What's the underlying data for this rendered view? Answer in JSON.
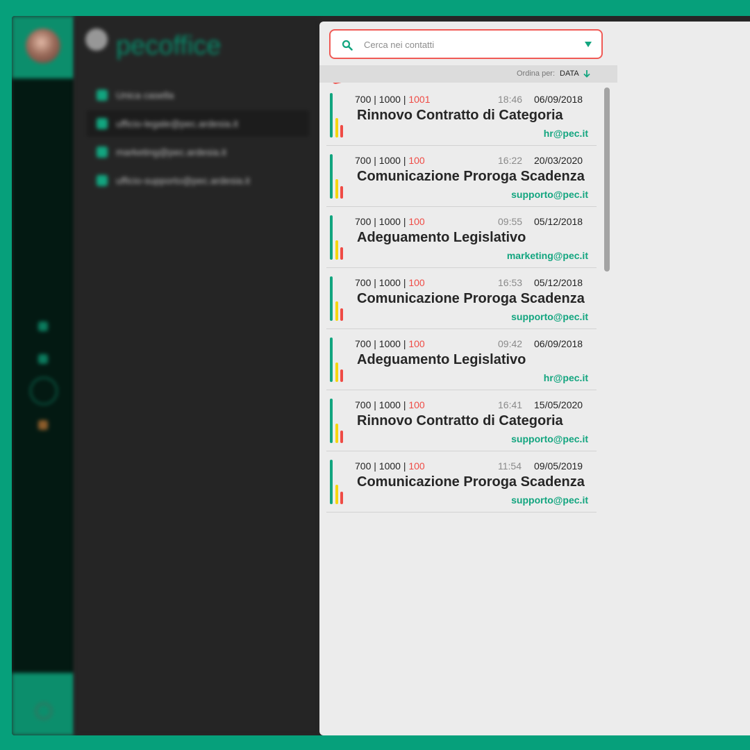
{
  "accounts": {
    "brand": "pecoffice",
    "items": [
      {
        "label": "Unica casella"
      },
      {
        "label": "ufficio-legale@pec.ardesia.it"
      },
      {
        "label": "marketing@pec.ardesia.it"
      },
      {
        "label": "ufficio-supporto@pec.ardesia.it"
      }
    ]
  },
  "search": {
    "placeholder": "Cerca nei contatti",
    "icon": "search-icon",
    "dropdown_icon": "triangle-down-icon"
  },
  "sort": {
    "label": "Ordina per:",
    "value": "DATA",
    "icon": "arrow-down-icon"
  },
  "messages": [
    {
      "c1": "700",
      "c2": "1000",
      "c3": "1001",
      "time": "18:46",
      "date": "06/09/2018",
      "subject": "Rinnovo Contratto di Categoria",
      "sender": "hr@pec.it"
    },
    {
      "c1": "700",
      "c2": "1000",
      "c3": "100",
      "time": "16:22",
      "date": "20/03/2020",
      "subject": "Comunicazione Proroga Scadenza",
      "sender": "supporto@pec.it"
    },
    {
      "c1": "700",
      "c2": "1000",
      "c3": "100",
      "time": "09:55",
      "date": "05/12/2018",
      "subject": "Adeguamento Legislativo",
      "sender": "marketing@pec.it"
    },
    {
      "c1": "700",
      "c2": "1000",
      "c3": "100",
      "time": "16:53",
      "date": "05/12/2018",
      "subject": "Comunicazione Proroga Scadenza",
      "sender": "supporto@pec.it"
    },
    {
      "c1": "700",
      "c2": "1000",
      "c3": "100",
      "time": "09:42",
      "date": "06/09/2018",
      "subject": "Adeguamento Legislativo",
      "sender": "hr@pec.it"
    },
    {
      "c1": "700",
      "c2": "1000",
      "c3": "100",
      "time": "16:41",
      "date": "15/05/2020",
      "subject": "Rinnovo Contratto di Categoria",
      "sender": "supporto@pec.it"
    },
    {
      "c1": "700",
      "c2": "1000",
      "c3": "100",
      "time": "11:54",
      "date": "09/05/2019",
      "subject": "Comunicazione Proroga Scadenza",
      "sender": "supporto@pec.it"
    }
  ],
  "colors": {
    "accent": "#12a57f",
    "background": "#06a07b",
    "alert": "#ef4b45",
    "warning": "#f5d60f"
  }
}
